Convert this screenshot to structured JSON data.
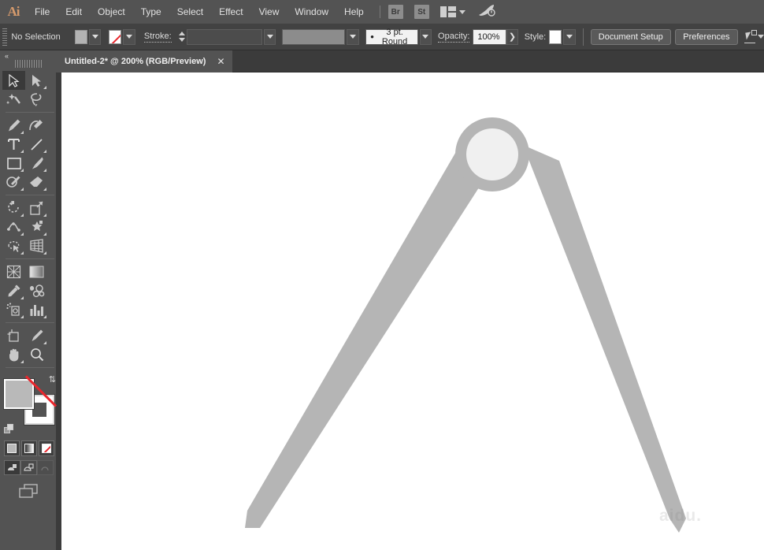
{
  "app": {
    "logo": "Ai",
    "title": "Adobe Illustrator"
  },
  "menubar": {
    "items": [
      {
        "label": "File"
      },
      {
        "label": "Edit"
      },
      {
        "label": "Object"
      },
      {
        "label": "Type"
      },
      {
        "label": "Select"
      },
      {
        "label": "Effect"
      },
      {
        "label": "View"
      },
      {
        "label": "Window"
      },
      {
        "label": "Help"
      }
    ],
    "bridge_button": "Br",
    "stock_button": "St",
    "workspace_icon": "workspace-layout-icon",
    "search_icon": "rocket-icon"
  },
  "controlbar": {
    "selection_status": "No Selection",
    "fill_label": "Fill",
    "fill_color": "#b3b3b3",
    "stroke_swatch_label": "Stroke color",
    "stroke_color": "none",
    "stroke_weight_label": "Stroke:",
    "stroke_weight_value": "",
    "stroke_profile_value": "",
    "brush_value": "3 pt. Round",
    "brush_bullet": "•",
    "opacity_label": "Opacity:",
    "opacity_value": "100%",
    "opacity_arrow": "❯",
    "style_label": "Style:",
    "style_color": "#f0f0f0",
    "document_setup_button": "Document Setup",
    "preferences_button": "Preferences",
    "select_similar_icon": "select-similar-icon"
  },
  "tabbar": {
    "document_tab": "Untitled-2* @ 200% (RGB/Preview)",
    "close_glyph": "✕"
  },
  "toolbar": {
    "collapse_glyph": "«",
    "tools": [
      {
        "name": "selection-tool",
        "active": true,
        "has_flyout": false
      },
      {
        "name": "direct-selection-tool",
        "active": false,
        "has_flyout": true
      },
      {
        "name": "magic-wand-tool",
        "active": false,
        "has_flyout": false
      },
      {
        "name": "lasso-tool",
        "active": false,
        "has_flyout": false
      },
      {
        "name": "pen-tool",
        "active": false,
        "has_flyout": true
      },
      {
        "name": "curvature-tool",
        "active": false,
        "has_flyout": false
      },
      {
        "name": "type-tool",
        "active": false,
        "has_flyout": true
      },
      {
        "name": "line-segment-tool",
        "active": false,
        "has_flyout": true
      },
      {
        "name": "rectangle-tool",
        "active": false,
        "has_flyout": true
      },
      {
        "name": "paintbrush-tool",
        "active": false,
        "has_flyout": true
      },
      {
        "name": "shaper-tool",
        "active": false,
        "has_flyout": true
      },
      {
        "name": "eraser-tool",
        "active": false,
        "has_flyout": true
      },
      {
        "name": "rotate-tool",
        "active": false,
        "has_flyout": true
      },
      {
        "name": "scale-tool",
        "active": false,
        "has_flyout": true
      },
      {
        "name": "width-tool",
        "active": false,
        "has_flyout": true
      },
      {
        "name": "free-transform-tool",
        "active": false,
        "has_flyout": true
      },
      {
        "name": "shape-builder-tool",
        "active": false,
        "has_flyout": true
      },
      {
        "name": "perspective-grid-tool",
        "active": false,
        "has_flyout": true
      },
      {
        "name": "mesh-tool",
        "active": false,
        "has_flyout": false
      },
      {
        "name": "gradient-tool",
        "active": false,
        "has_flyout": false
      },
      {
        "name": "eyedropper-tool",
        "active": false,
        "has_flyout": true
      },
      {
        "name": "blend-tool",
        "active": false,
        "has_flyout": false
      },
      {
        "name": "symbol-sprayer-tool",
        "active": false,
        "has_flyout": true
      },
      {
        "name": "column-graph-tool",
        "active": false,
        "has_flyout": true
      },
      {
        "name": "artboard-tool",
        "active": false,
        "has_flyout": false
      },
      {
        "name": "slice-tool",
        "active": false,
        "has_flyout": true
      },
      {
        "name": "hand-tool",
        "active": false,
        "has_flyout": true
      },
      {
        "name": "zoom-tool",
        "active": false,
        "has_flyout": false
      }
    ],
    "fill_color": "#b9b9b9",
    "stroke_color": "none",
    "swap_glyph": "⇅",
    "color_mode_label": "Color",
    "gradient_mode_label": "Gradient",
    "none_mode_label": "None",
    "screen_modes": [
      "normal-screen-mode",
      "full-screen-with-menu",
      "full-screen-mode"
    ],
    "arrange_documents": "arrange-documents-icon"
  },
  "canvas": {
    "zoom": "200%",
    "color_mode": "RGB",
    "view_mode": "Preview",
    "watermark_text": "aidu.",
    "artwork": {
      "name": "compass-divider-shape",
      "ring_color": "#b5b5b5",
      "inner_circle_color": "#f0f0f0",
      "leg_color": "#b5b5b5",
      "background": "#ffffff"
    }
  }
}
